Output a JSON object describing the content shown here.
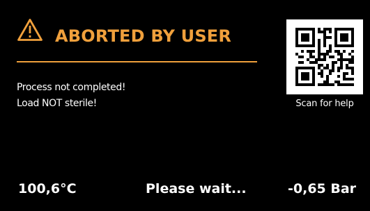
{
  "header": {
    "title": "ABORTED BY USER",
    "icon": "warning-triangle-icon",
    "accent_color": "#f0a03c"
  },
  "message": {
    "line1": "Process not completed!",
    "line2": "Load NOT sterile!"
  },
  "help": {
    "qr_icon": "qr-code-icon",
    "caption": "Scan for help"
  },
  "status_bar": {
    "temperature": "100,6°C",
    "state": "Please wait...",
    "pressure": "-0,65 Bar"
  },
  "colors": {
    "background": "#000000",
    "text": "#ffffff",
    "accent": "#f0a03c"
  }
}
